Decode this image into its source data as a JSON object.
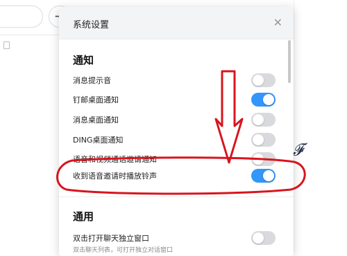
{
  "background": {
    "add_icon": "plus-icon"
  },
  "dialog": {
    "title": "系统设置",
    "close_icon": "close-icon",
    "sections": {
      "notify": {
        "title": "通知",
        "items": [
          {
            "label": "消息提示音",
            "on": false
          },
          {
            "label": "钉邮桌面通知",
            "on": true
          },
          {
            "label": "消息桌面通知",
            "on": false
          },
          {
            "label": "DING桌面通知",
            "on": false
          },
          {
            "label": "语音和视频通话邀请通知",
            "on": false
          },
          {
            "label": "收到语音邀请时播放铃声",
            "on": true
          }
        ]
      },
      "general": {
        "title": "通用",
        "items": [
          {
            "label": "双击打开聊天独立窗口",
            "sub": "双击聊天列表，可打开独立对话窗口",
            "on": false
          }
        ]
      }
    }
  },
  "colors": {
    "toggle_on": "#3296fa",
    "toggle_off": "#d9dadd",
    "annotation": "#d8141e"
  }
}
